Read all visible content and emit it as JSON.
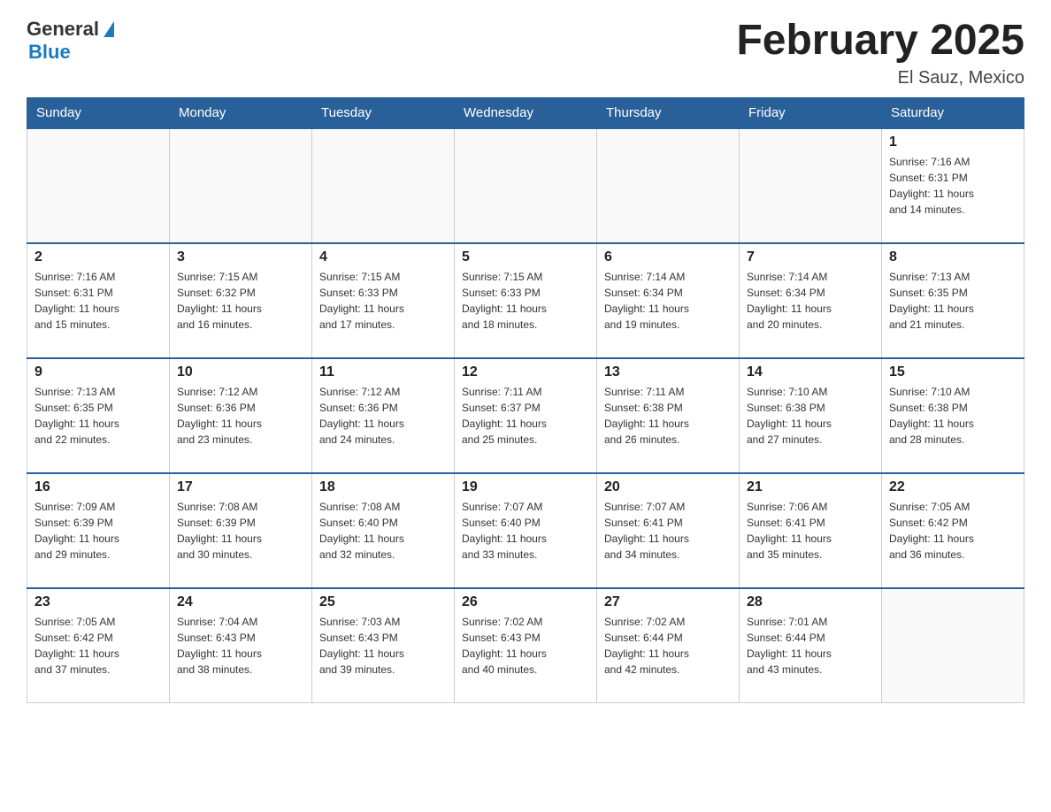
{
  "header": {
    "logo_general": "General",
    "logo_blue": "Blue",
    "month_title": "February 2025",
    "location": "El Sauz, Mexico"
  },
  "weekdays": [
    "Sunday",
    "Monday",
    "Tuesday",
    "Wednesday",
    "Thursday",
    "Friday",
    "Saturday"
  ],
  "weeks": [
    [
      {
        "day": "",
        "info": ""
      },
      {
        "day": "",
        "info": ""
      },
      {
        "day": "",
        "info": ""
      },
      {
        "day": "",
        "info": ""
      },
      {
        "day": "",
        "info": ""
      },
      {
        "day": "",
        "info": ""
      },
      {
        "day": "1",
        "info": "Sunrise: 7:16 AM\nSunset: 6:31 PM\nDaylight: 11 hours\nand 14 minutes."
      }
    ],
    [
      {
        "day": "2",
        "info": "Sunrise: 7:16 AM\nSunset: 6:31 PM\nDaylight: 11 hours\nand 15 minutes."
      },
      {
        "day": "3",
        "info": "Sunrise: 7:15 AM\nSunset: 6:32 PM\nDaylight: 11 hours\nand 16 minutes."
      },
      {
        "day": "4",
        "info": "Sunrise: 7:15 AM\nSunset: 6:33 PM\nDaylight: 11 hours\nand 17 minutes."
      },
      {
        "day": "5",
        "info": "Sunrise: 7:15 AM\nSunset: 6:33 PM\nDaylight: 11 hours\nand 18 minutes."
      },
      {
        "day": "6",
        "info": "Sunrise: 7:14 AM\nSunset: 6:34 PM\nDaylight: 11 hours\nand 19 minutes."
      },
      {
        "day": "7",
        "info": "Sunrise: 7:14 AM\nSunset: 6:34 PM\nDaylight: 11 hours\nand 20 minutes."
      },
      {
        "day": "8",
        "info": "Sunrise: 7:13 AM\nSunset: 6:35 PM\nDaylight: 11 hours\nand 21 minutes."
      }
    ],
    [
      {
        "day": "9",
        "info": "Sunrise: 7:13 AM\nSunset: 6:35 PM\nDaylight: 11 hours\nand 22 minutes."
      },
      {
        "day": "10",
        "info": "Sunrise: 7:12 AM\nSunset: 6:36 PM\nDaylight: 11 hours\nand 23 minutes."
      },
      {
        "day": "11",
        "info": "Sunrise: 7:12 AM\nSunset: 6:36 PM\nDaylight: 11 hours\nand 24 minutes."
      },
      {
        "day": "12",
        "info": "Sunrise: 7:11 AM\nSunset: 6:37 PM\nDaylight: 11 hours\nand 25 minutes."
      },
      {
        "day": "13",
        "info": "Sunrise: 7:11 AM\nSunset: 6:38 PM\nDaylight: 11 hours\nand 26 minutes."
      },
      {
        "day": "14",
        "info": "Sunrise: 7:10 AM\nSunset: 6:38 PM\nDaylight: 11 hours\nand 27 minutes."
      },
      {
        "day": "15",
        "info": "Sunrise: 7:10 AM\nSunset: 6:38 PM\nDaylight: 11 hours\nand 28 minutes."
      }
    ],
    [
      {
        "day": "16",
        "info": "Sunrise: 7:09 AM\nSunset: 6:39 PM\nDaylight: 11 hours\nand 29 minutes."
      },
      {
        "day": "17",
        "info": "Sunrise: 7:08 AM\nSunset: 6:39 PM\nDaylight: 11 hours\nand 30 minutes."
      },
      {
        "day": "18",
        "info": "Sunrise: 7:08 AM\nSunset: 6:40 PM\nDaylight: 11 hours\nand 32 minutes."
      },
      {
        "day": "19",
        "info": "Sunrise: 7:07 AM\nSunset: 6:40 PM\nDaylight: 11 hours\nand 33 minutes."
      },
      {
        "day": "20",
        "info": "Sunrise: 7:07 AM\nSunset: 6:41 PM\nDaylight: 11 hours\nand 34 minutes."
      },
      {
        "day": "21",
        "info": "Sunrise: 7:06 AM\nSunset: 6:41 PM\nDaylight: 11 hours\nand 35 minutes."
      },
      {
        "day": "22",
        "info": "Sunrise: 7:05 AM\nSunset: 6:42 PM\nDaylight: 11 hours\nand 36 minutes."
      }
    ],
    [
      {
        "day": "23",
        "info": "Sunrise: 7:05 AM\nSunset: 6:42 PM\nDaylight: 11 hours\nand 37 minutes."
      },
      {
        "day": "24",
        "info": "Sunrise: 7:04 AM\nSunset: 6:43 PM\nDaylight: 11 hours\nand 38 minutes."
      },
      {
        "day": "25",
        "info": "Sunrise: 7:03 AM\nSunset: 6:43 PM\nDaylight: 11 hours\nand 39 minutes."
      },
      {
        "day": "26",
        "info": "Sunrise: 7:02 AM\nSunset: 6:43 PM\nDaylight: 11 hours\nand 40 minutes."
      },
      {
        "day": "27",
        "info": "Sunrise: 7:02 AM\nSunset: 6:44 PM\nDaylight: 11 hours\nand 42 minutes."
      },
      {
        "day": "28",
        "info": "Sunrise: 7:01 AM\nSunset: 6:44 PM\nDaylight: 11 hours\nand 43 minutes."
      },
      {
        "day": "",
        "info": ""
      }
    ]
  ]
}
